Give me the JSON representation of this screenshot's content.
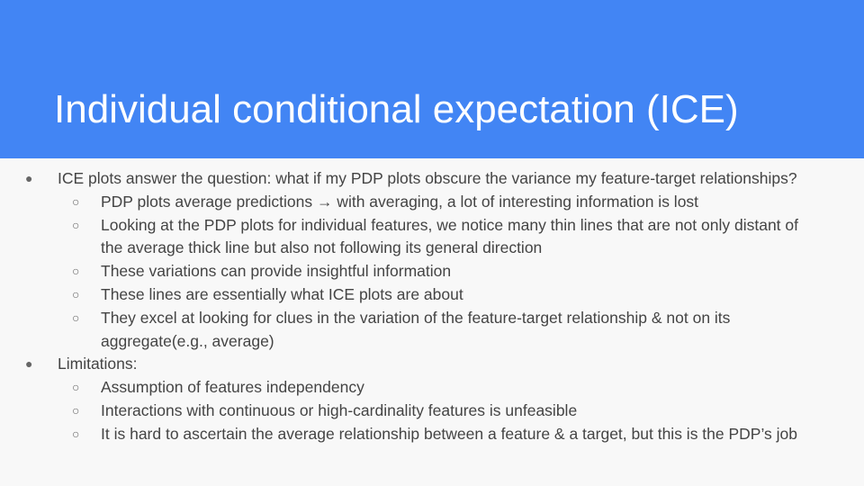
{
  "slide": {
    "title": "Individual conditional expectation (ICE)",
    "colors": {
      "header_background": "#4285f4",
      "title_text": "#ffffff",
      "body_background": "#f8f8f8",
      "body_text": "#444444"
    },
    "bullet_glyphs": {
      "level1": "●",
      "level2": "○"
    },
    "bullets": [
      {
        "level": 1,
        "lines": [
          "ICE plots answer the question: what if my PDP plots obscure the variance my feature-target relationships?"
        ]
      },
      {
        "level": 2,
        "lines": [
          "PDP plots average predictions → with averaging, a lot of interesting information is lost"
        ]
      },
      {
        "level": 2,
        "lines": [
          "Looking at the PDP plots for individual features, we notice many thin lines that are not only distant of",
          "the average thick line but also not following its general direction"
        ]
      },
      {
        "level": 2,
        "lines": [
          "These variations can provide insightful information"
        ]
      },
      {
        "level": 2,
        "lines": [
          "These lines are essentially what ICE plots are about"
        ]
      },
      {
        "level": 2,
        "lines": [
          "They excel at looking for clues in the variation of the feature-target relationship & not on its",
          "aggregate(e.g., average)"
        ]
      },
      {
        "level": 1,
        "lines": [
          "Limitations:"
        ]
      },
      {
        "level": 2,
        "lines": [
          "Assumption of features independency"
        ]
      },
      {
        "level": 2,
        "lines": [
          "Interactions with continuous or high-cardinality features is unfeasible"
        ]
      },
      {
        "level": 2,
        "lines": [
          "It is hard to ascertain the average relationship between a feature & a target, but this is the PDP’s job"
        ]
      }
    ]
  }
}
